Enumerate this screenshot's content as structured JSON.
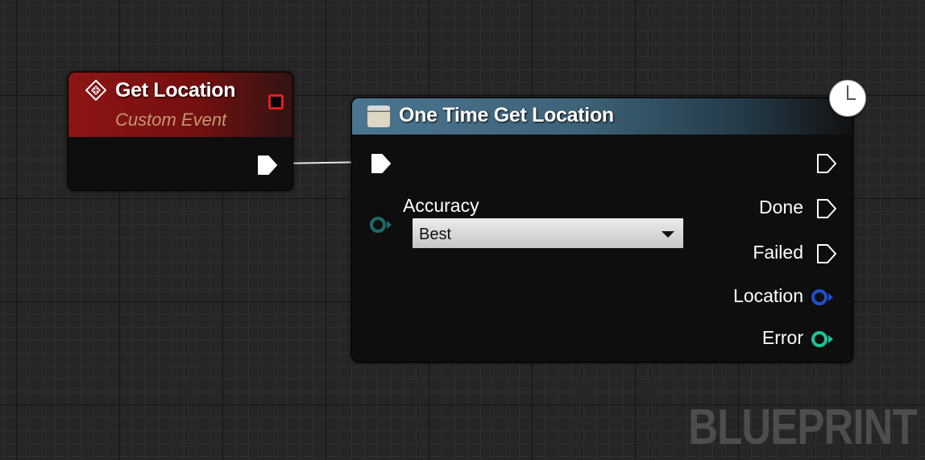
{
  "event_node": {
    "title": "Get Location",
    "subtitle": "Custom Event",
    "icon": "event-diamond-icon",
    "header_color": "#8e1414",
    "subtitle_color": "#c2986e",
    "delegate_pin_color": "#e02020"
  },
  "call_node": {
    "title": "One Time Get Location",
    "icon": "function-icon",
    "header_color": "#4a7590",
    "latent_icon": "clock-icon",
    "inputs": {
      "accuracy": {
        "label": "Accuracy",
        "value": "Best",
        "pin_color": "#1c6a6a"
      }
    },
    "outputs": {
      "done": "Done",
      "failed": "Failed",
      "location": "Location",
      "error": "Error"
    },
    "colors": {
      "location_pin": "#1f4fd0",
      "error_pin": "#1dc29a",
      "exec_pin": "#ffffff"
    }
  },
  "watermark": "BLUEPRINT"
}
